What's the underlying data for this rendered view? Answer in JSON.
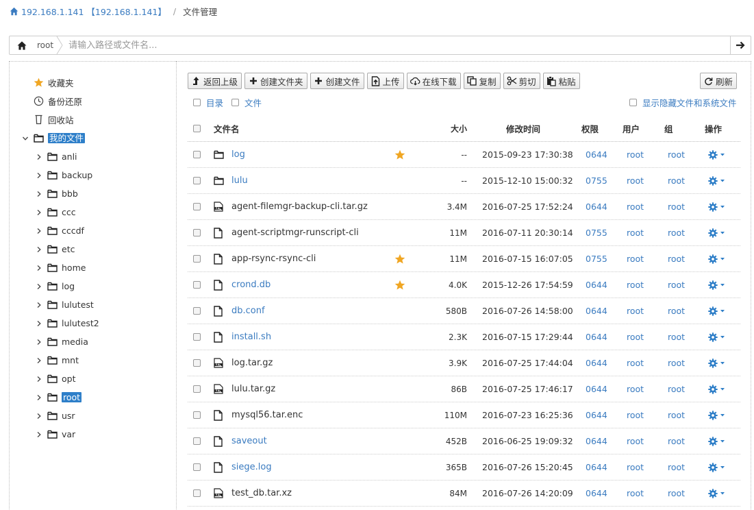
{
  "breadcrumb": {
    "host": "192.168.1.141 【192.168.1.141】",
    "separator": "/",
    "current": "文件管理"
  },
  "pathbar": {
    "segment": "root",
    "placeholder": "请输入路径或文件名..."
  },
  "sidebar": {
    "favorites": "收藏夹",
    "backup": "备份还原",
    "recycle": "回收站",
    "my_files": "我的文件",
    "folders": [
      "anli",
      "backup",
      "bbb",
      "ccc",
      "cccdf",
      "etc",
      "home",
      "log",
      "lulutest",
      "lulutest2",
      "media",
      "mnt",
      "opt",
      "root",
      "usr",
      "var"
    ],
    "selected": "root"
  },
  "toolbar": {
    "up": "返回上级",
    "new_folder": "创建文件夹",
    "new_file": "创建文件",
    "upload": "上传",
    "online_download": "在线下载",
    "copy": "复制",
    "cut": "剪切",
    "paste": "粘贴",
    "refresh": "刷新"
  },
  "filters": {
    "dirs": "目录",
    "files": "文件",
    "show_hidden": "显示隐藏文件和系统文件"
  },
  "table": {
    "headers": {
      "name": "文件名",
      "size": "大小",
      "mtime": "修改时间",
      "perm": "权限",
      "user": "用户",
      "group": "组",
      "ops": "操作"
    },
    "rows": [
      {
        "type": "folder",
        "name": "log",
        "link": true,
        "star": true,
        "size": "--",
        "mtime": "2015-09-23 17:30:38",
        "perm": "0644",
        "user": "root",
        "group": "root"
      },
      {
        "type": "folder",
        "name": "lulu",
        "link": true,
        "star": false,
        "size": "--",
        "mtime": "2015-12-10 15:00:32",
        "perm": "0755",
        "user": "root",
        "group": "root"
      },
      {
        "type": "archive",
        "name": "agent-filemgr-backup-cli.tar.gz",
        "link": false,
        "star": false,
        "size": "3.4M",
        "mtime": "2016-07-25 17:52:24",
        "perm": "0644",
        "user": "root",
        "group": "root"
      },
      {
        "type": "file",
        "name": "agent-scriptmgr-runscript-cli",
        "link": false,
        "star": false,
        "size": "11M",
        "mtime": "2016-07-11 20:30:14",
        "perm": "0755",
        "user": "root",
        "group": "root"
      },
      {
        "type": "file",
        "name": "app-rsync-rsync-cli",
        "link": false,
        "star": true,
        "size": "11M",
        "mtime": "2016-07-15 16:07:05",
        "perm": "0755",
        "user": "root",
        "group": "root"
      },
      {
        "type": "file",
        "name": "crond.db",
        "link": true,
        "star": true,
        "size": "4.0K",
        "mtime": "2015-12-26 17:54:59",
        "perm": "0644",
        "user": "root",
        "group": "root"
      },
      {
        "type": "file",
        "name": "db.conf",
        "link": true,
        "star": false,
        "size": "580B",
        "mtime": "2016-07-26 14:58:00",
        "perm": "0644",
        "user": "root",
        "group": "root"
      },
      {
        "type": "file",
        "name": "install.sh",
        "link": true,
        "star": false,
        "size": "2.3K",
        "mtime": "2016-07-15 17:29:44",
        "perm": "0644",
        "user": "root",
        "group": "root"
      },
      {
        "type": "archive",
        "name": "log.tar.gz",
        "link": false,
        "star": false,
        "size": "3.9K",
        "mtime": "2016-07-25 17:44:04",
        "perm": "0644",
        "user": "root",
        "group": "root"
      },
      {
        "type": "archive",
        "name": "lulu.tar.gz",
        "link": false,
        "star": false,
        "size": "86B",
        "mtime": "2016-07-25 17:46:17",
        "perm": "0644",
        "user": "root",
        "group": "root"
      },
      {
        "type": "file",
        "name": "mysql56.tar.enc",
        "link": false,
        "star": false,
        "size": "110M",
        "mtime": "2016-07-23 16:25:36",
        "perm": "0644",
        "user": "root",
        "group": "root"
      },
      {
        "type": "file",
        "name": "saveout",
        "link": true,
        "star": false,
        "size": "452B",
        "mtime": "2016-06-25 19:09:32",
        "perm": "0644",
        "user": "root",
        "group": "root"
      },
      {
        "type": "file",
        "name": "siege.log",
        "link": true,
        "star": false,
        "size": "365B",
        "mtime": "2016-07-26 15:20:45",
        "perm": "0644",
        "user": "root",
        "group": "root"
      },
      {
        "type": "archive",
        "name": "test_db.tar.xz",
        "link": false,
        "star": false,
        "size": "84M",
        "mtime": "2016-07-26 14:20:09",
        "perm": "0644",
        "user": "root",
        "group": "root"
      }
    ]
  },
  "colors": {
    "link": "#3a7bc0",
    "accent_star": "#f0a623",
    "selected_bg": "#2e7fc9",
    "gear": "#2f7fc8"
  }
}
